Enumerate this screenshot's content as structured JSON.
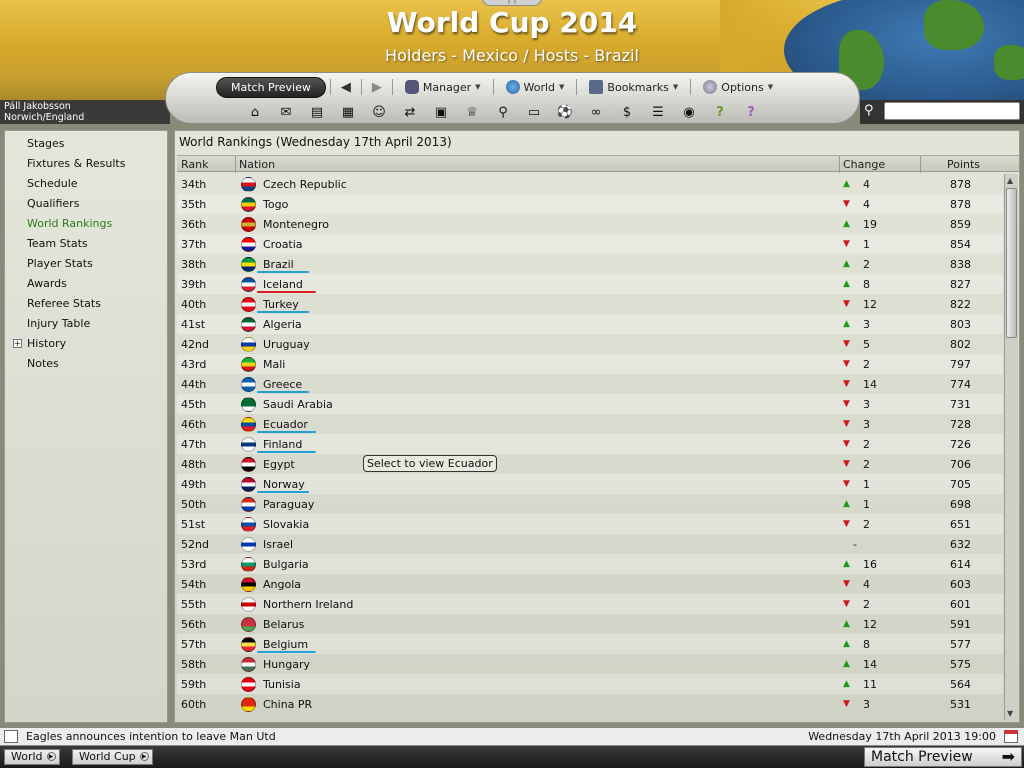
{
  "header": {
    "title": "World Cup 2014",
    "subtitle": "Holders - Mexico / Hosts - Brazil"
  },
  "user": {
    "name": "Páll Jakobsson",
    "club": "Norwich/England"
  },
  "nav": {
    "match_preview": "Match Preview",
    "manager": "Manager",
    "world": "World",
    "bookmarks": "Bookmarks",
    "options": "Options"
  },
  "search": {
    "placeholder": ""
  },
  "sidebar": {
    "items": [
      {
        "label": "Stages"
      },
      {
        "label": "Fixtures & Results"
      },
      {
        "label": "Schedule"
      },
      {
        "label": "Qualifiers"
      },
      {
        "label": "World Rankings"
      },
      {
        "label": "Team Stats"
      },
      {
        "label": "Player Stats"
      },
      {
        "label": "Awards"
      },
      {
        "label": "Referee Stats"
      },
      {
        "label": "Injury Table"
      },
      {
        "label": "History"
      },
      {
        "label": "Notes"
      }
    ],
    "active_index": 4
  },
  "main": {
    "title": "World Rankings (Wednesday 17th April 2013)",
    "columns": {
      "rank": "Rank",
      "nation": "Nation",
      "change": "Change",
      "points": "Points"
    },
    "rows": [
      {
        "rank": "34th",
        "nation": "Czech Republic",
        "dir": "up",
        "change": "4",
        "points": "878"
      },
      {
        "rank": "35th",
        "nation": "Togo",
        "dir": "down",
        "change": "4",
        "points": "878"
      },
      {
        "rank": "36th",
        "nation": "Montenegro",
        "dir": "up",
        "change": "19",
        "points": "859"
      },
      {
        "rank": "37th",
        "nation": "Croatia",
        "dir": "down",
        "change": "1",
        "points": "854"
      },
      {
        "rank": "38th",
        "nation": "Brazil",
        "dir": "up",
        "change": "2",
        "points": "838"
      },
      {
        "rank": "39th",
        "nation": "Iceland",
        "dir": "up",
        "change": "8",
        "points": "827"
      },
      {
        "rank": "40th",
        "nation": "Turkey",
        "dir": "down",
        "change": "12",
        "points": "822"
      },
      {
        "rank": "41st",
        "nation": "Algeria",
        "dir": "up",
        "change": "3",
        "points": "803"
      },
      {
        "rank": "42nd",
        "nation": "Uruguay",
        "dir": "down",
        "change": "5",
        "points": "802"
      },
      {
        "rank": "43rd",
        "nation": "Mali",
        "dir": "down",
        "change": "2",
        "points": "797"
      },
      {
        "rank": "44th",
        "nation": "Greece",
        "dir": "down",
        "change": "14",
        "points": "774"
      },
      {
        "rank": "45th",
        "nation": "Saudi Arabia",
        "dir": "down",
        "change": "3",
        "points": "731"
      },
      {
        "rank": "46th",
        "nation": "Ecuador",
        "dir": "down",
        "change": "3",
        "points": "728"
      },
      {
        "rank": "47th",
        "nation": "Finland",
        "dir": "down",
        "change": "2",
        "points": "726"
      },
      {
        "rank": "48th",
        "nation": "Egypt",
        "dir": "down",
        "change": "2",
        "points": "706"
      },
      {
        "rank": "49th",
        "nation": "Norway",
        "dir": "down",
        "change": "1",
        "points": "705"
      },
      {
        "rank": "50th",
        "nation": "Paraguay",
        "dir": "up",
        "change": "1",
        "points": "698"
      },
      {
        "rank": "51st",
        "nation": "Slovakia",
        "dir": "down",
        "change": "2",
        "points": "651"
      },
      {
        "rank": "52nd",
        "nation": "Israel",
        "dir": "none",
        "change": "-",
        "points": "632"
      },
      {
        "rank": "53rd",
        "nation": "Bulgaria",
        "dir": "up",
        "change": "16",
        "points": "614"
      },
      {
        "rank": "54th",
        "nation": "Angola",
        "dir": "down",
        "change": "4",
        "points": "603"
      },
      {
        "rank": "55th",
        "nation": "Northern Ireland",
        "dir": "down",
        "change": "2",
        "points": "601"
      },
      {
        "rank": "56th",
        "nation": "Belarus",
        "dir": "up",
        "change": "12",
        "points": "591"
      },
      {
        "rank": "57th",
        "nation": "Belgium",
        "dir": "up",
        "change": "8",
        "points": "577"
      },
      {
        "rank": "58th",
        "nation": "Hungary",
        "dir": "up",
        "change": "14",
        "points": "575"
      },
      {
        "rank": "59th",
        "nation": "Tunisia",
        "dir": "up",
        "change": "11",
        "points": "564"
      },
      {
        "rank": "60th",
        "nation": "China PR",
        "dir": "down",
        "change": "3",
        "points": "531"
      }
    ]
  },
  "tooltip": "Select to view Ecuador",
  "status": {
    "news": "Eagles announces intention to leave Man Utd",
    "date": "Wednesday 17th April 2013 19:00"
  },
  "bottom": {
    "crumbs": [
      "World",
      "World Cup"
    ],
    "continue": "Match Preview"
  },
  "colors": {
    "accent_active": "#2b7a1a",
    "up": "#1c9a1c",
    "down": "#cc1a1a",
    "underline_blue": "#1fa3d6",
    "underline_red": "#d81f1f"
  }
}
